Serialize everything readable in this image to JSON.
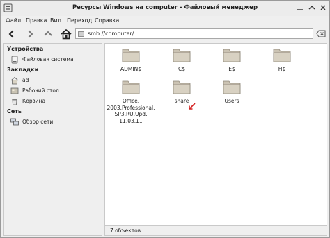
{
  "window": {
    "title": "Ресурсы Windows на computer - Файловый менеджер"
  },
  "menu": [
    "Файл",
    "Правка",
    "Вид",
    "Переход",
    "Справка"
  ],
  "toolbar": {
    "address": "smb://computer/"
  },
  "sidebar": {
    "sections": [
      {
        "heading": "Устройства",
        "items": [
          {
            "label": "Файловая система",
            "icon": "drive-icon"
          }
        ]
      },
      {
        "heading": "Закладки",
        "items": [
          {
            "label": "ad",
            "icon": "home-folder-icon"
          },
          {
            "label": "Рабочий стол",
            "icon": "desktop-icon"
          },
          {
            "label": "Корзина",
            "icon": "trash-icon"
          }
        ]
      },
      {
        "heading": "Сеть",
        "items": [
          {
            "label": "Обзор сети",
            "icon": "network-icon"
          }
        ]
      }
    ]
  },
  "files": [
    {
      "name": "ADMIN$"
    },
    {
      "name": "C$"
    },
    {
      "name": "E$"
    },
    {
      "name": "H$"
    },
    {
      "name": "Office.\n2003.Professional.\nSP3.RU.Upd.\n11.03.11"
    },
    {
      "name": "share"
    },
    {
      "name": "Users"
    }
  ],
  "status": {
    "text": "7 объектов"
  }
}
